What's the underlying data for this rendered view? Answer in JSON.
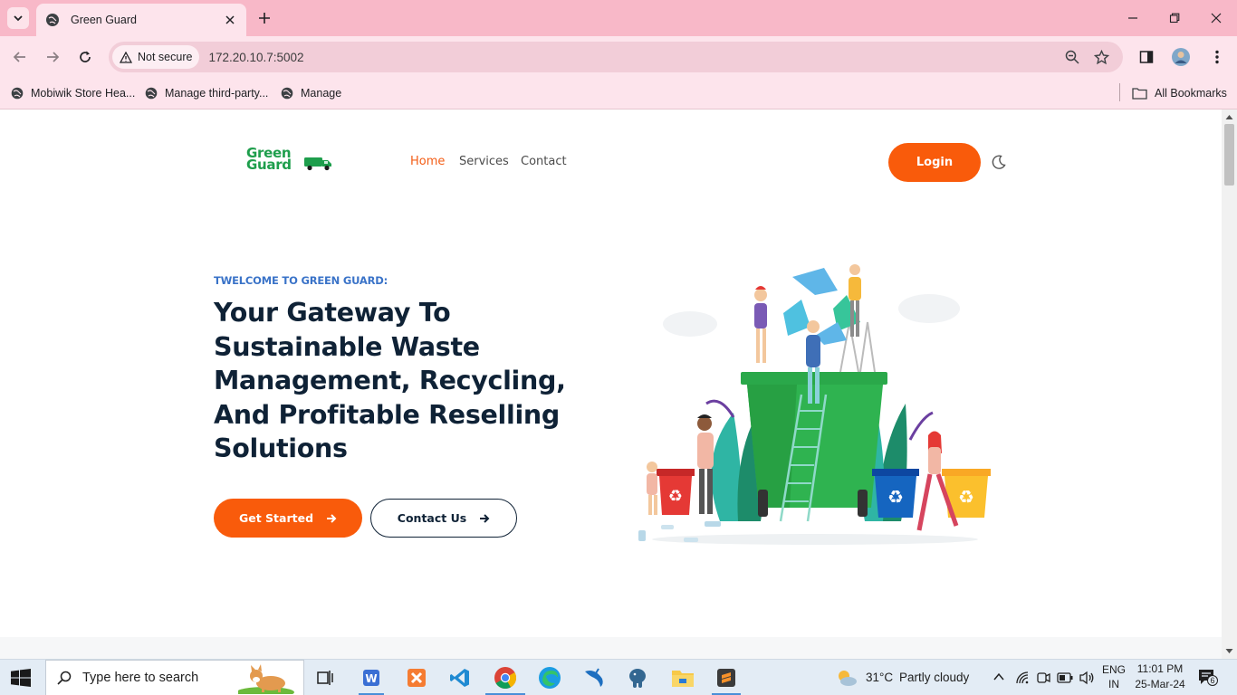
{
  "browser": {
    "tab_title": "Green Guard",
    "security_label": "Not secure",
    "url": "172.20.10.7:5002",
    "bookmarks": [
      {
        "label": "Mobiwik Store Hea..."
      },
      {
        "label": "Manage third-party..."
      },
      {
        "label": "Manage"
      }
    ],
    "all_bookmarks_label": "All Bookmarks"
  },
  "site": {
    "logo_line1": "Green",
    "logo_line2": "Guard",
    "nav": [
      {
        "label": "Home",
        "active": true
      },
      {
        "label": "Services",
        "active": false
      },
      {
        "label": "Contact",
        "active": false
      }
    ],
    "login_label": "Login"
  },
  "hero": {
    "eyebrow": "TWELCOME TO GREEN GUARD:",
    "headline_lines": [
      "Your Gateway To",
      "Sustainable Waste",
      "Management, Recycling,",
      "And Profitable Reselling",
      "Solutions"
    ],
    "primary_cta": "Get Started",
    "secondary_cta": "Contact Us"
  },
  "taskbar": {
    "search_placeholder": "Type here to search",
    "weather_temp": "31°C",
    "weather_desc": "Partly cloudy",
    "lang_line1": "ENG",
    "lang_line2": "IN",
    "time": "11:01 PM",
    "date": "25-Mar-24",
    "notification_count": "6"
  },
  "colors": {
    "accent_orange": "#f95b0b",
    "brand_green": "#1e9e4c",
    "heading_navy": "#0f2236",
    "eyebrow_blue": "#3a73c8",
    "chrome_pink": "#f8b8c8"
  }
}
